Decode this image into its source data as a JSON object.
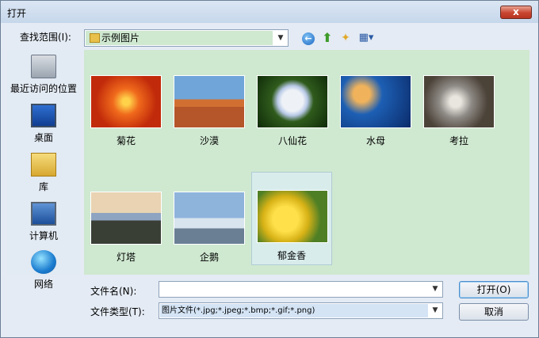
{
  "window": {
    "title": "打开",
    "close_label": "x"
  },
  "toolbar": {
    "look_in_label": "查找范围(I):",
    "look_in_value": "示例图片",
    "back_glyph": "←",
    "up_glyph": "⬆",
    "new_folder_glyph": "✦",
    "view_glyph": "▦▾"
  },
  "places": [
    {
      "label": "最近访问的位置",
      "icon": "recent-places-icon"
    },
    {
      "label": "桌面",
      "icon": "desktop-icon"
    },
    {
      "label": "库",
      "icon": "library-icon"
    },
    {
      "label": "计算机",
      "icon": "computer-icon"
    },
    {
      "label": "网络",
      "icon": "network-icon"
    }
  ],
  "files": [
    {
      "name": "菊花"
    },
    {
      "name": "沙漠"
    },
    {
      "name": "八仙花"
    },
    {
      "name": "水母"
    },
    {
      "name": "考拉"
    },
    {
      "name": "灯塔"
    },
    {
      "name": "企鹅"
    },
    {
      "name": "郁金香",
      "selected": true
    }
  ],
  "footer": {
    "file_name_label": "文件名(N):",
    "file_name_value": "",
    "file_type_label": "文件类型(T):",
    "file_type_value": "图片文件(*.jpg;*.jpeg;*.bmp;*.gif;*.png)",
    "open_label": "打开(O)",
    "cancel_label": "取消"
  },
  "colors": {
    "list_bg": "#cfe8d0",
    "close_red": "#c8452f"
  }
}
